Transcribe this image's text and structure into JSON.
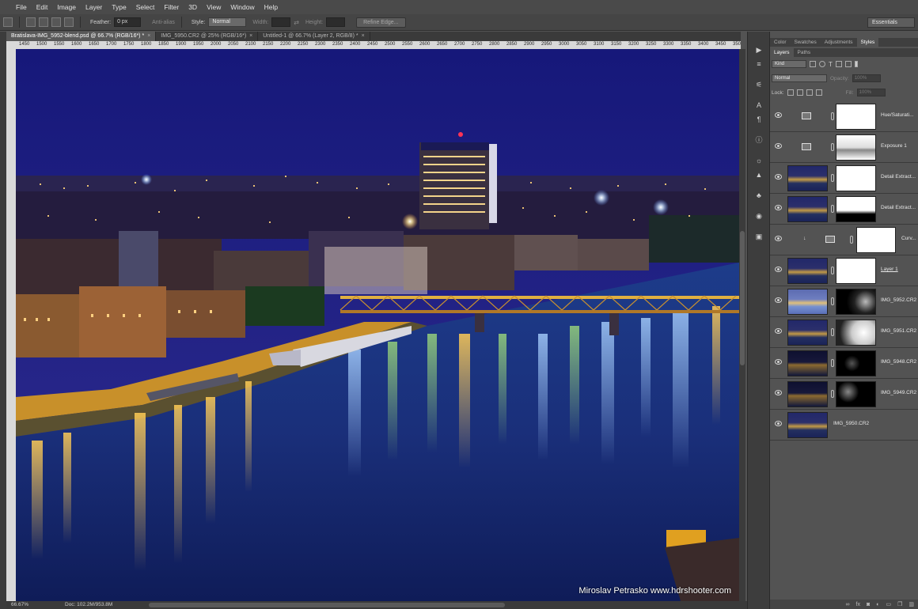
{
  "menubar": {
    "items": [
      "File",
      "Edit",
      "Image",
      "Layer",
      "Type",
      "Select",
      "Filter",
      "3D",
      "View",
      "Window",
      "Help"
    ]
  },
  "options": {
    "feather_label": "Feather:",
    "feather_value": "0 px",
    "antialias_label": "Anti-alias",
    "style_label": "Style:",
    "style_value": "Normal",
    "width_label": "Width:",
    "height_label": "Height:",
    "refine_edge": "Refine Edge...",
    "workspace": "Essentials"
  },
  "tabs": [
    {
      "label": "Bratislava-IMG_5952-blend.psd @ 66.7% (RGB/16*) *"
    },
    {
      "label": "IMG_5950.CR2 @ 25% (RGB/16*)"
    },
    {
      "label": "Untitled-1 @ 66.7% (Layer 2, RGB/8) *"
    }
  ],
  "ruler": {
    "ticks": [
      "1450",
      "1500",
      "1550",
      "1600",
      "1650",
      "1700",
      "1750",
      "1800",
      "1850",
      "1900",
      "1950",
      "2000",
      "2050",
      "2100",
      "2150",
      "2200",
      "2250",
      "2300",
      "2350",
      "2400",
      "2450",
      "2500",
      "2550",
      "2600",
      "2650",
      "2700",
      "2750",
      "2800",
      "2850",
      "2900",
      "2950",
      "3000",
      "3050",
      "3100",
      "3150",
      "3200",
      "3250",
      "3300",
      "3350",
      "3400",
      "3450",
      "3500",
      "3550"
    ]
  },
  "canvas": {
    "watermark": "Miroslav Petrasko www.hdrshooter.com"
  },
  "status": {
    "zoom": "66.67%",
    "doc": "Doc: 102.2M/953.8M"
  },
  "panels": {
    "top_tabs": [
      "Color",
      "Swatches",
      "Adjustments",
      "Styles"
    ],
    "layer_tabs": [
      "Layers",
      "Paths"
    ],
    "kind": "Kind",
    "blend_mode": "Normal",
    "opacity_label": "Opacity:",
    "opacity_value": "100%",
    "lock_label": "Lock:",
    "fill_label": "Fill:",
    "fill_value": "100%"
  },
  "layers": [
    {
      "name": "Hue/Saturati...",
      "type": "adjustment"
    },
    {
      "name": "Exposure 1",
      "type": "adjustment"
    },
    {
      "name": "Detail Extract...",
      "type": "image"
    },
    {
      "name": "Detail Extract...",
      "type": "image"
    },
    {
      "name": "Curv...",
      "type": "curves"
    },
    {
      "name": "Layer 1",
      "type": "image"
    },
    {
      "name": "IMG_5952.CR2",
      "type": "image"
    },
    {
      "name": "IMG_5951.CR2",
      "type": "image"
    },
    {
      "name": "IMG_5948.CR2",
      "type": "image"
    },
    {
      "name": "IMG_5949.CR2",
      "type": "image"
    },
    {
      "name": "IMG_5950.CR2",
      "type": "image"
    }
  ]
}
